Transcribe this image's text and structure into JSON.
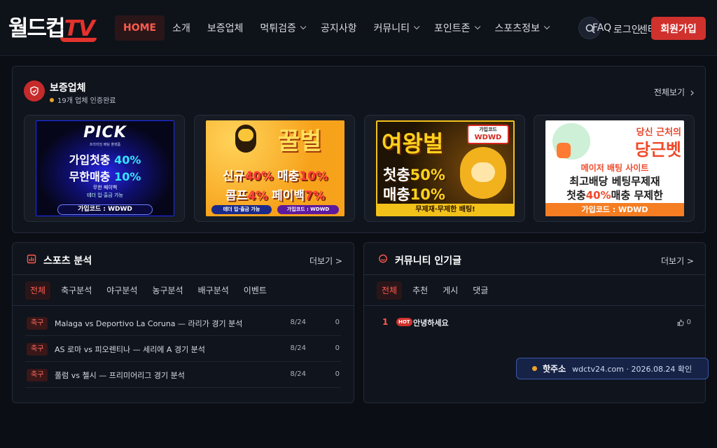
{
  "brand": {
    "logo_ko": "월드컵",
    "logo_tv": "TV"
  },
  "nav": {
    "items": [
      {
        "label": "HOME",
        "active": true,
        "dropdown": false
      },
      {
        "label": "소개",
        "active": false,
        "dropdown": false
      },
      {
        "label": "보증업체",
        "active": false,
        "dropdown": false
      },
      {
        "label": "먹튀검증",
        "active": false,
        "dropdown": true
      },
      {
        "label": "공지사항",
        "active": false,
        "dropdown": false
      },
      {
        "label": "커뮤니티",
        "active": false,
        "dropdown": true
      },
      {
        "label": "포인트존",
        "active": false,
        "dropdown": true
      },
      {
        "label": "스포츠정보",
        "active": false,
        "dropdown": true
      }
    ],
    "faq": "FAQ",
    "login": "로그인",
    "center": "센터",
    "join": "회원가입"
  },
  "partners": {
    "title": "보증업체",
    "subtitle": "19개 업체 인증완료",
    "see_all": "전체보기",
    "banners": [
      {
        "brand": "PICK",
        "tagline": "프리미엄 베팅 플랫폼",
        "line1_prefix": "가입첫충 ",
        "line1_value": "40%",
        "line2_prefix": "무한매충 ",
        "line2_value": "10%",
        "line3": "무한 페이백",
        "line4": "테더 입·출금 가능",
        "code": "가입코드 : WDWD"
      },
      {
        "brand": "꿀벌",
        "line1_a": "신규",
        "line1_b": "40%",
        "line1_c": "매충",
        "line1_d": "10%",
        "line2_a": "콤프",
        "line2_b": "4%",
        "line2_c": "페이백",
        "line2_d": "7%",
        "pill1": "테더 입·출금 가능",
        "pill2": "가입코드 : WDWD"
      },
      {
        "brand": "여왕벌",
        "code_label": "가입코드",
        "code": "WDWD",
        "line1_a": "첫충",
        "line1_b": "50%",
        "line2_a": "매충",
        "line2_b": "10%",
        "bottom": "무제재·무제한 배팅!"
      },
      {
        "tag": "당신 근처의",
        "brand": "당근벳",
        "line1": "메이저 배팅 사이트",
        "line2": "최고배당 베팅무제재",
        "line3_a": "첫충",
        "line3_b": "40%",
        "line3_c": "매충 무제한",
        "code": "가입코드 : WDWD"
      }
    ]
  },
  "sports": {
    "title": "스포츠 분석",
    "more": "더보기 >",
    "tabs": [
      "전체",
      "축구분석",
      "야구분석",
      "농구분석",
      "배구분석",
      "이벤트"
    ],
    "rows": [
      {
        "badge": "축구",
        "title": "Malaga vs Deportivo La Coruna — 라리가 경기 분석",
        "date": "8/24",
        "count": "0"
      },
      {
        "badge": "축구",
        "title": "AS 로마 vs 피오렌티나 — 세리에 A 경기 분석",
        "date": "8/24",
        "count": "0"
      },
      {
        "badge": "축구",
        "title": "풀럼 vs 첼시 — 프리미어리그 경기 분석",
        "date": "8/24",
        "count": "0"
      }
    ]
  },
  "community": {
    "title": "커뮤니티 인기글",
    "more": "더보기 >",
    "tabs": [
      "전체",
      "추천",
      "게시",
      "댓글"
    ],
    "rows": [
      {
        "rank": "1",
        "hot": "HOT",
        "title": "안녕하세요",
        "likes": "0"
      }
    ]
  },
  "toast": {
    "label": "핫주소",
    "value": "wdctv24.com · 2026.08.24 확인"
  },
  "colors": {
    "accent": "#d0312d",
    "background": "#0b0e14",
    "panel": "#10141c",
    "toast": "#162347"
  }
}
